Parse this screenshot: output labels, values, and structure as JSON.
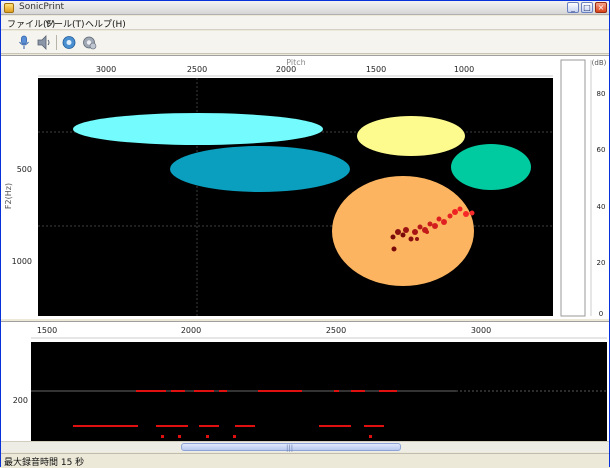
{
  "window": {
    "title": "SonicPrint",
    "controls": [
      "_",
      "□",
      "×"
    ]
  },
  "menu": {
    "items": [
      "ファイル(F)",
      "ツール(T)",
      "ヘルプ(H)"
    ]
  },
  "toolbar": {
    "icons": [
      "microphone-icon",
      "speaker-icon",
      "settings-icon",
      "gear-icon"
    ]
  },
  "spectrogram": {
    "top_axis_ticks": [
      "3000",
      "2500",
      "2000",
      "1500",
      "1000"
    ],
    "top_axis_label": "Pitch",
    "left_axis_ticks": [
      "500",
      "1000"
    ],
    "left_axis_label": "F2(Hz)"
  },
  "level_meter": {
    "unit": "(dB)",
    "ticks": [
      "80",
      "60",
      "40",
      "20",
      "0"
    ]
  },
  "timeline": {
    "top_axis_ticks": [
      "1500",
      "2000",
      "2500",
      "3000"
    ],
    "left_axis_ticks": [
      "200"
    ]
  },
  "status": {
    "text": "最大録音時間 15 秒"
  },
  "colors": {
    "cyan": "#73fbfd",
    "teal": "#0a9fbf",
    "yellow": "#fefb8e",
    "green": "#00cba0",
    "orange": "#fdb460",
    "points": "#e01010"
  }
}
